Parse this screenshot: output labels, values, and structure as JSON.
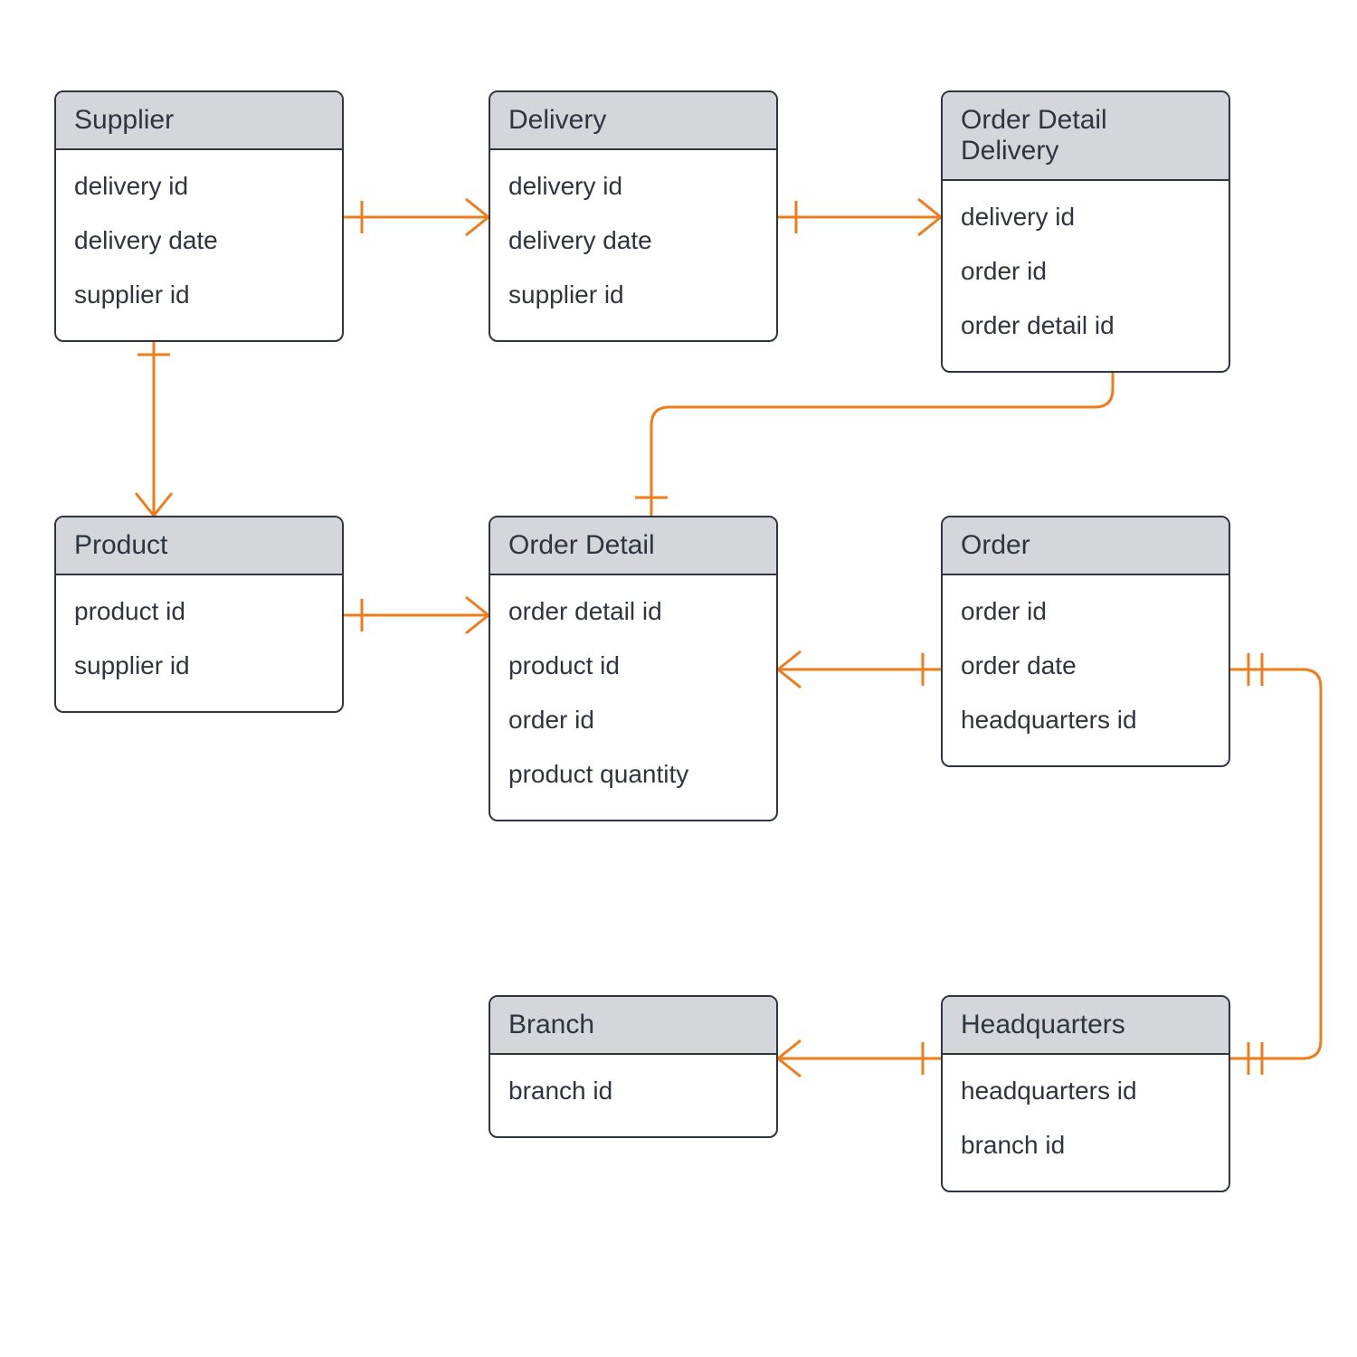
{
  "entities": {
    "supplier": {
      "title": "Supplier",
      "attrs": [
        "delivery id",
        "delivery date",
        "supplier id"
      ]
    },
    "delivery": {
      "title": "Delivery",
      "attrs": [
        "delivery id",
        "delivery date",
        "supplier id"
      ]
    },
    "order_detail_delivery": {
      "title": "Order Detail Delivery",
      "attrs": [
        "delivery id",
        "order id",
        "order detail id"
      ]
    },
    "product": {
      "title": "Product",
      "attrs": [
        "product id",
        "supplier id"
      ]
    },
    "order_detail": {
      "title": "Order Detail",
      "attrs": [
        "order detail id",
        "product id",
        "order id",
        "product quantity"
      ]
    },
    "order": {
      "title": "Order",
      "attrs": [
        "order id",
        "order date",
        "headquarters id"
      ]
    },
    "branch": {
      "title": "Branch",
      "attrs": [
        "branch id"
      ]
    },
    "headquarters": {
      "title": "Headquarters",
      "attrs": [
        "headquarters id",
        "branch id"
      ]
    }
  },
  "relationships": [
    {
      "from": "supplier",
      "to": "delivery",
      "type": "one-to-many"
    },
    {
      "from": "delivery",
      "to": "order_detail_delivery",
      "type": "one-to-many"
    },
    {
      "from": "supplier",
      "to": "product",
      "type": "one-to-many"
    },
    {
      "from": "product",
      "to": "order_detail",
      "type": "one-to-many"
    },
    {
      "from": "order_detail",
      "to": "order_detail_delivery",
      "type": "one-to-many"
    },
    {
      "from": "order",
      "to": "order_detail",
      "type": "one-to-many"
    },
    {
      "from": "headquarters",
      "to": "order",
      "type": "one-to-one"
    },
    {
      "from": "headquarters",
      "to": "branch",
      "type": "one-to-many"
    }
  ],
  "colors": {
    "connector": "#ee7c1a",
    "entity_border": "#2e3440",
    "entity_header": "#d4d6d9"
  }
}
